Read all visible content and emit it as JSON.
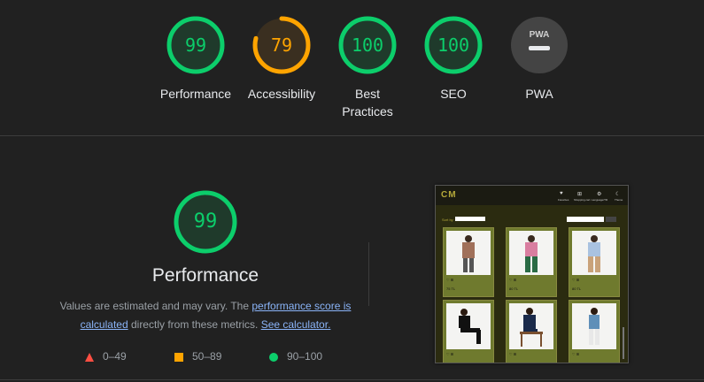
{
  "summary_gauges": [
    {
      "score": "99",
      "label": "Performance",
      "fraction": 0.99,
      "color": "#0cce6b"
    },
    {
      "score": "79",
      "label": "Accessibility",
      "fraction": 0.79,
      "color": "#ffa400"
    },
    {
      "score": "100",
      "label": "Best Practices",
      "fraction": 1.0,
      "color": "#0cce6b"
    },
    {
      "score": "100",
      "label": "SEO",
      "fraction": 1.0,
      "color": "#0cce6b"
    },
    {
      "score": "PWA",
      "label": "PWA",
      "fraction": 0,
      "color": "#9aa0a6"
    }
  ],
  "performance": {
    "score": "99",
    "title": "Performance",
    "desc_prefix": "Values are estimated and may vary. The ",
    "link_score": "performance score is calculated",
    "desc_mid": " directly from these metrics. ",
    "link_calc": "See calculator."
  },
  "legend": [
    {
      "shape": "triangle",
      "range": "0–49",
      "color": "#ff4e42"
    },
    {
      "shape": "square",
      "range": "50–89",
      "color": "#ffa400"
    },
    {
      "shape": "circle",
      "range": "90–100",
      "color": "#0cce6b"
    }
  ],
  "thumbnail": {
    "logo": "CM",
    "nav": [
      "Favorites",
      "Shopping cart",
      "Language/TR",
      "Theme"
    ],
    "sort_label": "Sort by",
    "products": [
      {
        "price": "75 TL"
      },
      {
        "price": "80 TL"
      },
      {
        "price": "80 TL"
      },
      {
        "price": ""
      },
      {
        "price": ""
      },
      {
        "price": ""
      }
    ]
  }
}
